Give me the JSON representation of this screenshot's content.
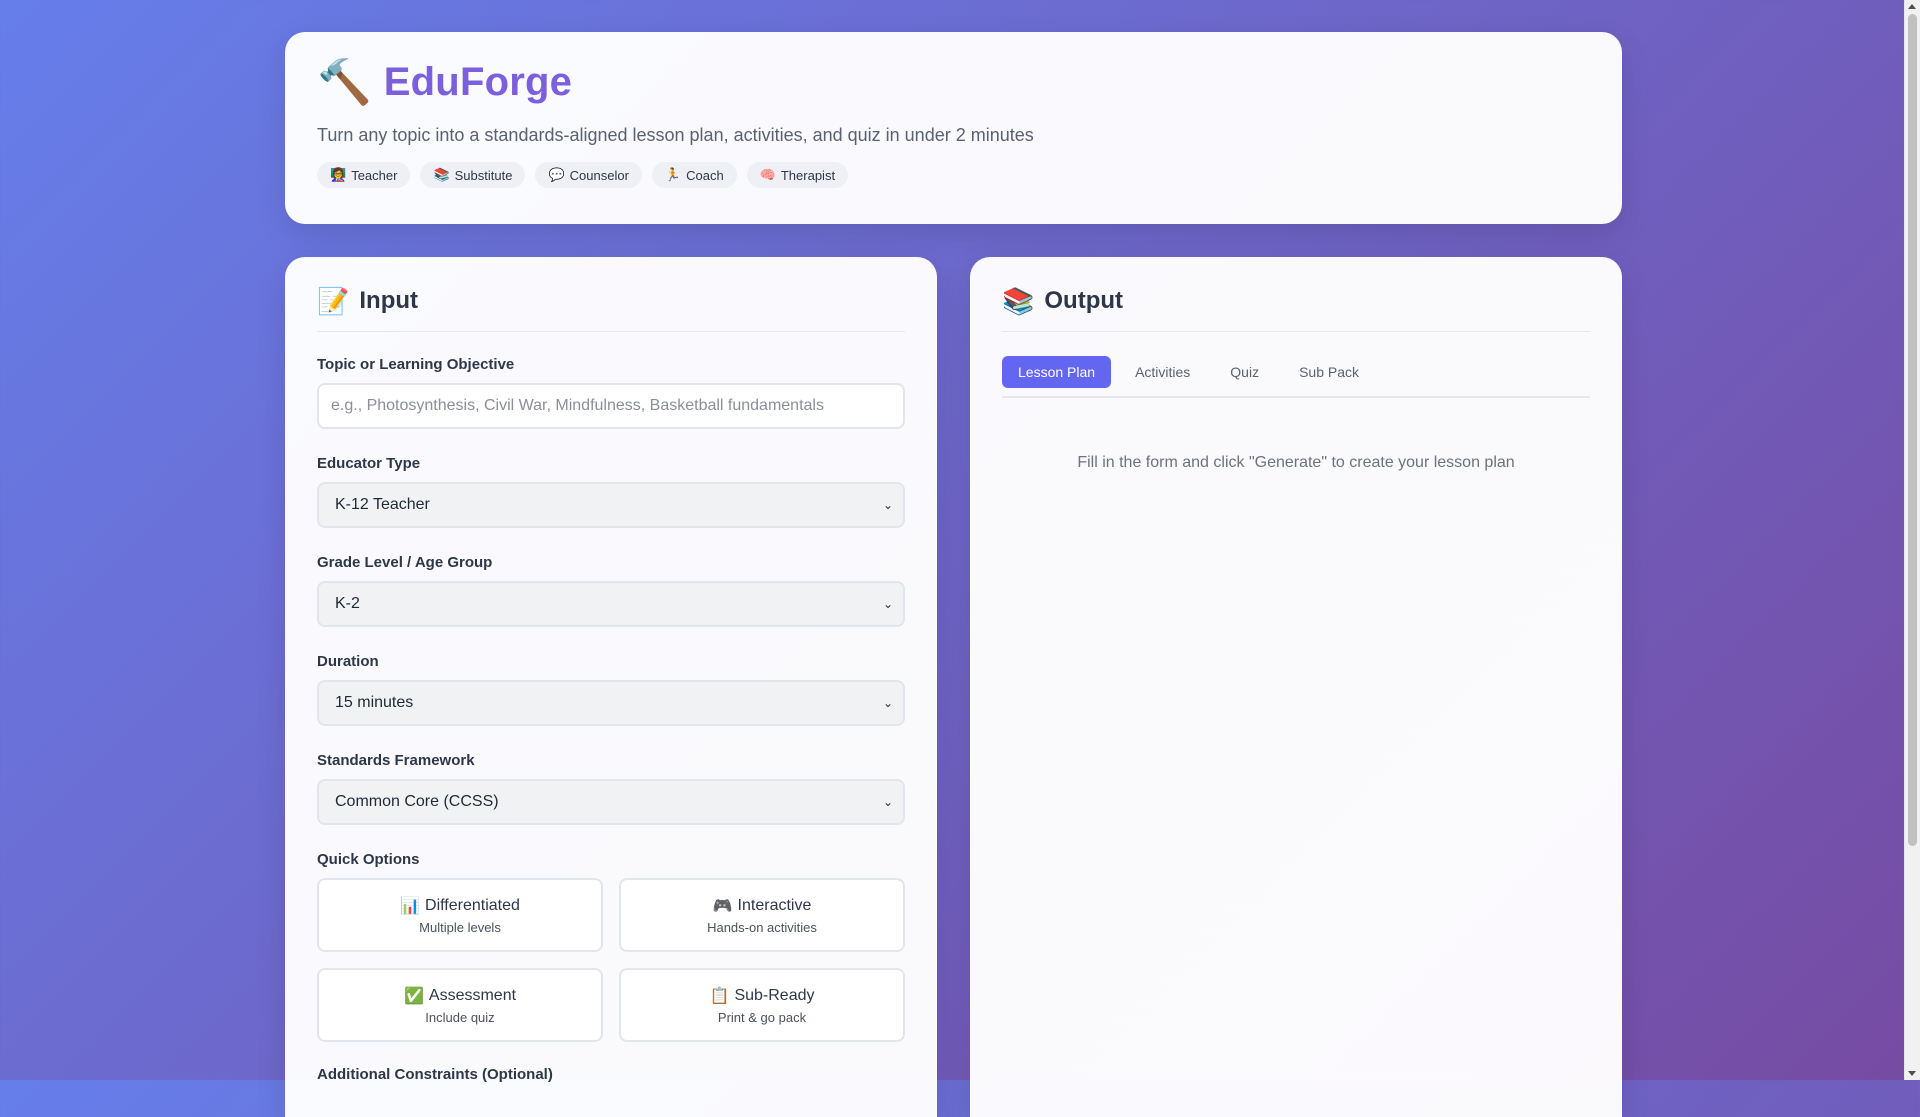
{
  "header": {
    "icon": "hammer-icon",
    "icon_glyph": "🔨",
    "title": "EduForge",
    "subtitle": "Turn any topic into a standards-aligned lesson plan, activities, and quiz in under 2 minutes",
    "roles": [
      {
        "glyph": "👩‍🏫",
        "label": "Teacher",
        "icon": "teacher-icon"
      },
      {
        "glyph": "📚",
        "label": "Substitute",
        "icon": "books-icon"
      },
      {
        "glyph": "💬",
        "label": "Counselor",
        "icon": "speech-bubble-icon"
      },
      {
        "glyph": "🏃",
        "label": "Coach",
        "icon": "runner-icon"
      },
      {
        "glyph": "🧠",
        "label": "Therapist",
        "icon": "brain-icon"
      }
    ]
  },
  "input": {
    "icon_glyph": "📝",
    "title": "Input",
    "topic": {
      "label": "Topic or Learning Objective",
      "value": "",
      "placeholder": "e.g., Photosynthesis, Civil War, Mindfulness, Basketball fundamentals"
    },
    "educator_type": {
      "label": "Educator Type",
      "value": "K-12 Teacher"
    },
    "grade_level": {
      "label": "Grade Level / Age Group",
      "value": "K-2"
    },
    "duration": {
      "label": "Duration",
      "value": "15 minutes"
    },
    "standards": {
      "label": "Standards Framework",
      "value": "Common Core (CCSS)"
    },
    "quick_options": {
      "label": "Quick Options",
      "items": [
        {
          "glyph": "📊",
          "title": "Differentiated",
          "sub": "Multiple levels",
          "icon": "bar-chart-icon"
        },
        {
          "glyph": "🎮",
          "title": "Interactive",
          "sub": "Hands-on activities",
          "icon": "gamepad-icon"
        },
        {
          "glyph": "✅",
          "title": "Assessment",
          "sub": "Include quiz",
          "icon": "check-icon"
        },
        {
          "glyph": "📋",
          "title": "Sub-Ready",
          "sub": "Print & go pack",
          "icon": "clipboard-icon"
        }
      ]
    },
    "constraints": {
      "label": "Additional Constraints (Optional)"
    }
  },
  "output": {
    "icon_glyph": "📚",
    "title": "Output",
    "tabs": [
      "Lesson Plan",
      "Activities",
      "Quiz",
      "Sub Pack"
    ],
    "active_tab": "Lesson Plan",
    "empty_message": "Fill in the form and click \"Generate\" to create your lesson plan"
  },
  "colors": {
    "bg_start": "#667eea",
    "bg_end": "#764ba2",
    "brand": "#7c5fdc",
    "accent": "#6366f1"
  }
}
